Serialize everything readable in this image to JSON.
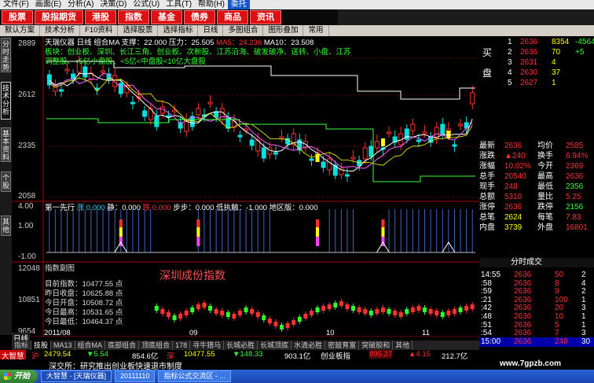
{
  "colors": {
    "up": "#ff3030",
    "down": "#00e0e0",
    "ma5": "#ffffff",
    "ma10": "#ff60ff",
    "ma20": "#ffff00",
    "ma60": "#40ff40",
    "bg": "#000000",
    "taskbar": "#2458c8"
  },
  "menu": {
    "items": [
      "文件(F)",
      "画面(E)",
      "分析(A)",
      "决策(D)",
      "公式(U)",
      "工具(T)",
      "帮助(H)"
    ],
    "highlight": "委托"
  },
  "categories": [
    "股票",
    "股指期货",
    "港股",
    "指数",
    "基金",
    "债券",
    "商品",
    "资讯"
  ],
  "toolbar": {
    "items": [
      "默认方案",
      "技术分析",
      "F10资料",
      "选择股票",
      "选择指标",
      "日线",
      "多图组合",
      "图形叠加",
      "常用"
    ]
  },
  "left_tabs": [
    "分时走势",
    "技术分析",
    "基本资料",
    "个股",
    "其他"
  ],
  "chart": {
    "title": "天瑞仪器 日线",
    "indicator": "组合MA",
    "support_label": "支撑：",
    "support": "22.000",
    "pressure_label": "压力：",
    "pressure": "25.505",
    "ma5_label": "MA5：",
    "ma5": "24.236",
    "ma10_label": "MA10：",
    "ma10": "23.508",
    "sectors_text": "板块：创业板、深圳、长江三角、创业板、次新股、江苏沿海、破发破净、送转、小盘、江苏",
    "sectors_text2": "调整股、<5亿小盘股、<5亿<中盘股<10亿大盘股",
    "yticks": [
      "2889",
      "2612",
      "2335",
      "2058"
    ],
    "osc_label": "第一先行",
    "osc_items": [
      "涨 0.000",
      "静：0.000",
      "跌 0.000",
      "步步：0.000",
      "低执触：-1.000",
      "地区版：0.000"
    ],
    "osc_ticks": [
      "4.00",
      "1.00",
      "-1.00"
    ],
    "index_panel_label": "指数副图",
    "index_name": "深圳成份指数",
    "index_yticks": [
      "12048",
      "10851",
      "9654"
    ],
    "index_stats": [
      {
        "label": "目前指数：",
        "value": "10477.55",
        "unit": "点"
      },
      {
        "label": "昨日收盘：",
        "value": "10625.88",
        "unit": "点"
      },
      {
        "label": "今日开盘：",
        "value": "10508.72",
        "unit": "点"
      },
      {
        "label": "今日最高：",
        "value": "10531.65",
        "unit": "点"
      },
      {
        "label": "今日最低：",
        "value": "10464.37",
        "unit": "点"
      }
    ],
    "date_label": "2011/08",
    "date_ticks": [
      "09",
      "10",
      "11"
    ],
    "period_label": "日线"
  },
  "quote": {
    "buy_label": "买",
    "sell_label": "盘",
    "book": [
      {
        "level": "1",
        "price": "2636",
        "vol": "8354",
        "chg": "-4564"
      },
      {
        "level": "2",
        "price": "2636",
        "vol": "70",
        "chg": "+5"
      },
      {
        "level": "3",
        "price": "2631",
        "vol": "4",
        "chg": ""
      },
      {
        "level": "4",
        "price": "2630",
        "vol": "37",
        "chg": ""
      },
      {
        "level": "5",
        "price": "2627",
        "vol": "1",
        "chg": ""
      }
    ],
    "stats": [
      {
        "l1": "最新",
        "v1": "2636",
        "l2": "均价",
        "v2": "2585"
      },
      {
        "l1": "涨跌",
        "v1": "▲240",
        "l2": "换手",
        "v2": "6.94%"
      },
      {
        "l1": "涨幅",
        "v1": "10.02%",
        "l2": "今开",
        "v2": "2369"
      },
      {
        "l1": "总手",
        "v1": "20540",
        "l2": "最高",
        "v2": "2636"
      },
      {
        "l1": "现手",
        "v1": "248",
        "l2": "最低",
        "v2": "2356"
      },
      {
        "l1": "总额",
        "v1": "5310",
        "l2": "量比",
        "v2": "5.25"
      },
      {
        "l1": "涨停",
        "v1": "2636",
        "l2": "跌停",
        "v2": "2156"
      },
      {
        "l1": "总笔",
        "v1": "2624",
        "l2": "每笔",
        "v2": "7.83"
      },
      {
        "l1": "内盘",
        "v1": "3739",
        "l2": "外盘",
        "v2": "16801"
      }
    ],
    "ticks_title": "分时成交",
    "ticks": [
      {
        "time": "14:55",
        "price": "2636",
        "vol": "50",
        "side": "2"
      },
      {
        "time": ":58",
        "price": "2636",
        "vol": "8",
        "side": "4"
      },
      {
        "time": ":59",
        "price": "2636",
        "vol": "9",
        "side": "2"
      },
      {
        "time": ":21",
        "price": "2636",
        "vol": "100",
        "side": "1"
      },
      {
        "time": ":42",
        "price": "2636",
        "vol": "20",
        "side": "3"
      },
      {
        "time": ":48",
        "price": "2636",
        "vol": "10",
        "side": "1"
      },
      {
        "time": ":51",
        "price": "2636",
        "vol": "5",
        "side": "1"
      },
      {
        "time": ":54",
        "price": "2636",
        "vol": "7",
        "side": "3"
      },
      {
        "time": "15:00",
        "price": "2636",
        "vol": "248",
        "side": "30"
      }
    ]
  },
  "bottom_tabs": [
    "指标",
    "技股",
    "MA13",
    "组合MA",
    "底部组合",
    "顶底组合",
    "178",
    "寻牛猎马",
    "长城必胜",
    "长城顶底",
    "水清必胜",
    "密敲育富",
    "突破胶和",
    "其他"
  ],
  "index_bar": {
    "sh_label": "沪",
    "sh_value": "2479.54",
    "sh_chg": "▼5.54",
    "sh_amt": "854.6亿",
    "sz_label": "深",
    "sz_value": "10477.55",
    "sz_chg": "▼148.33",
    "sz_amt": "903.1亿",
    "cy_label": "创业板指",
    "cy_value": "895.27",
    "cy_chg": "▲4.15",
    "cy_amt": "212.7亿"
  },
  "news": {
    "source": "大智慧",
    "text": "深交所：研究推出创业板快速退市制度",
    "site": "www.7gpzb.com"
  },
  "taskbar": {
    "start": "开始",
    "tasks": [
      "大智慧 - [天瑞仪器]",
      "20111110",
      "指标公式交流区 - ..."
    ]
  }
}
